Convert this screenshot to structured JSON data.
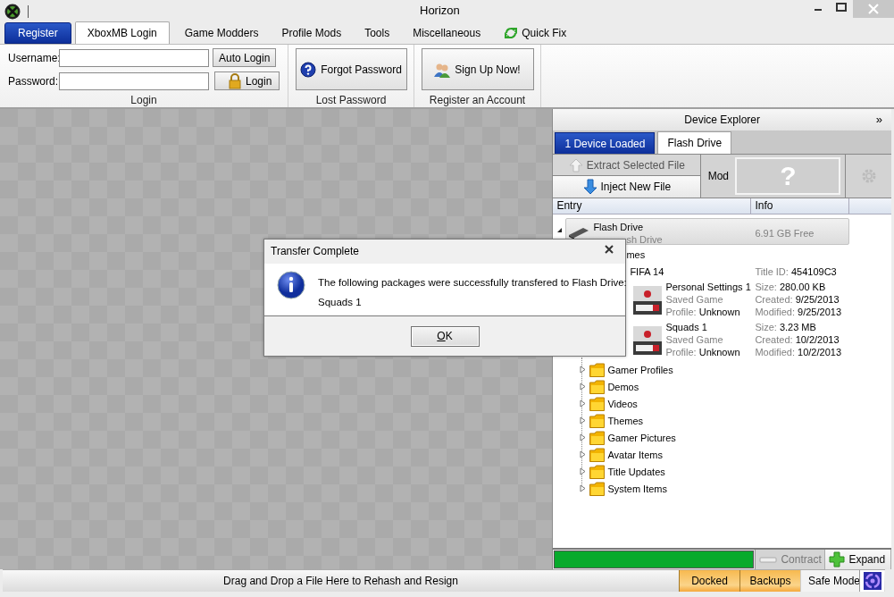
{
  "window": {
    "title": "Horizon"
  },
  "tabs": [
    {
      "label": "Register",
      "kind": "accent",
      "selected": false
    },
    {
      "label": "XboxMB Login",
      "kind": "plain",
      "selected": true
    },
    {
      "label": "Game Modders",
      "kind": "plain",
      "selected": false
    },
    {
      "label": "Profile Mods",
      "kind": "plain",
      "selected": false
    },
    {
      "label": "Tools",
      "kind": "plain",
      "selected": false
    },
    {
      "label": "Miscellaneous",
      "kind": "plain",
      "selected": false
    },
    {
      "label": "Quick Fix",
      "kind": "refresh",
      "selected": false
    }
  ],
  "login": {
    "username_label": "Username:",
    "password_label": "Password:",
    "auto_login": "Auto Login",
    "login": "Login",
    "group": "Login"
  },
  "lost_password": {
    "button": "Forgot Password",
    "group": "Lost Password"
  },
  "register": {
    "button": "Sign Up Now!",
    "group": "Register an Account"
  },
  "explorer": {
    "title": "Device Explorer",
    "collapse": "»",
    "device_tabs": [
      {
        "label": "1 Device Loaded",
        "kind": "accent",
        "selected": false
      },
      {
        "label": "Flash Drive",
        "kind": "plain",
        "selected": true
      }
    ],
    "extract": {
      "label": "Extract Selected File",
      "disabled": true
    },
    "inject": "Inject New File",
    "mod_label": "Mod",
    "mod_preview": "?",
    "columns": [
      "Entry",
      "Info"
    ],
    "drive": {
      "name": "Flash Drive",
      "subtitle": "sh Drive",
      "info": "6.91 GB Free",
      "expanded": true
    },
    "games_folder": "mes",
    "game": {
      "name": "FIFA 14",
      "info_label": "Title ID:",
      "info_value": "454109C3"
    },
    "files": [
      {
        "name": "Personal Settings 1",
        "type": "Saved Game",
        "profile_label": "Profile:",
        "profile": "Unknown",
        "size_label": "Size:",
        "size": "280.00 KB",
        "created_label": "Created:",
        "created": "9/25/2013",
        "modified_label": "Modified:",
        "modified": "9/25/2013"
      },
      {
        "name": "Squads 1",
        "type": "Saved Game",
        "profile_label": "Profile:",
        "profile": "Unknown",
        "size_label": "Size:",
        "size": "3.23 MB",
        "created_label": "Created:",
        "created": "10/2/2013",
        "modified_label": "Modified:",
        "modified": "10/2/2013"
      }
    ],
    "folders": [
      "Gamer Profiles",
      "Demos",
      "Videos",
      "Themes",
      "Gamer Pictures",
      "Avatar Items",
      "Title Updates",
      "System Items"
    ],
    "progress": {
      "level": 1
    },
    "contract": {
      "label": "Contract",
      "disabled": true
    },
    "expand": "Expand"
  },
  "dialog": {
    "title": "Transfer Complete",
    "message": "The following packages were successfully transfered to Flash Drive:",
    "items": [
      "Squads 1"
    ],
    "ok": "OK"
  },
  "status_bar": {
    "message": "Drag and Drop a File Here to Rehash and Resign",
    "toggles": [
      {
        "label": "Docked",
        "on": true
      },
      {
        "label": "Backups",
        "on": true
      },
      {
        "label": "Safe Mode",
        "on": false
      }
    ]
  }
}
